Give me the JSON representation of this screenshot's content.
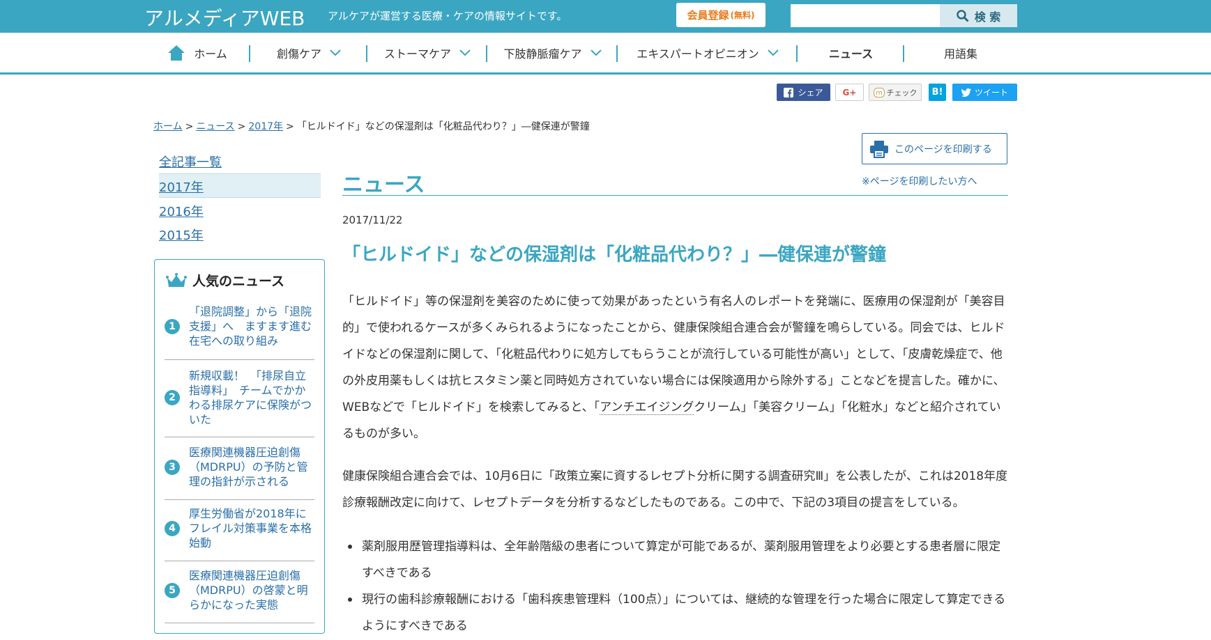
{
  "header": {
    "logo": "アルメディアWEB",
    "tagline": "アルケアが運営する医療・ケアの情報サイトです。",
    "register_label": "会員登録",
    "register_note": "(無料)",
    "search_placeholder": "",
    "search_button": "検 索"
  },
  "nav": [
    {
      "label": "ホーム"
    },
    {
      "label": "創傷ケア"
    },
    {
      "label": "ストーマケア"
    },
    {
      "label": "下肢静脈瘤ケア"
    },
    {
      "label": "エキスパートオピニオン"
    },
    {
      "label": "ニュース"
    },
    {
      "label": "用語集"
    }
  ],
  "social": {
    "facebook": "シェア",
    "google": "G+",
    "mixi": "チェック",
    "hatena": "B!",
    "twitter": "ツイート"
  },
  "breadcrumb": {
    "home": "ホーム",
    "news": "ニュース",
    "year": "2017年",
    "current": "「ヒルドイド」などの保湿剤は「化粧品代わり？」―健保連が警鐘"
  },
  "sidebar": {
    "links": [
      "全記事一覧",
      "2017年",
      "2016年",
      "2015年"
    ],
    "popular_title": "人気のニュース",
    "popular": [
      {
        "num": "1",
        "text": "「退院調整」から「退院支援」へ　ますます進む在宅への取り組み"
      },
      {
        "num": "2",
        "text": "新規収載！　「排尿自立指導料」　チームでかかわる排尿ケアに保険がついた"
      },
      {
        "num": "3",
        "text": "医療関連機器圧迫創傷（MDRPU）の予防と管理の指針が示される"
      },
      {
        "num": "4",
        "text": "厚生労働省が2018年にフレイル対策事業を本格始動"
      },
      {
        "num": "5",
        "text": "医療関連機器圧迫創傷（MDRPU）の啓蒙と明らかになった実態"
      }
    ]
  },
  "print": {
    "button": "このページを印刷する",
    "note": "※ページを印刷したい方へ"
  },
  "main": {
    "section_title": "ニュース",
    "date": "2017/11/22",
    "title": "「ヒルドイド」などの保湿剤は「化粧品代わり？」―健保連が警鐘",
    "para1_a": "「ヒルドイド」等の保湿剤を美容のために使って効果があったという有名人のレポートを発端に、医療用の保湿剤が「美容目的」で使われるケースが多くみられるようになったことから、健康保険組合連合会が警鐘を鳴らしている。同会では、ヒルドイドなどの保湿剤に関して、「化粧品代わりに処方してもらうことが流行している可能性が高い」として、「皮膚乾燥症で、他の外皮用薬もしくは抗ヒスタミン薬と同時処方されていない場合には保険適用から除外する」ことなどを提言した。確かに、WEBなどで「ヒルドイド」を検索してみると、「",
    "para1_link": "アンチエイジング",
    "para1_b": "クリーム」「美容クリーム」「化粧水」などと紹介されているものが多い。",
    "para2": "健康保険組合連合会では、10月6日に「政策立案に資するレセプト分析に関する調査研究Ⅲ」を公表したが、これは2018年度診療報酬改定に向けて、レセプトデータを分析するなどしたものである。この中で、下記の3項目の提言をしている。",
    "bullets": [
      "薬剤服用歴管理指導料は、全年齢階級の患者について算定が可能であるが、薬剤服用管理をより必要とする患者層に限定すべきである",
      "現行の歯科診療報酬における「歯科疾患管理料（100点）」については、継続的な管理を行った場合に限定して算定できるようにすべきである"
    ]
  },
  "colors": {
    "brand": "#3aa6c2",
    "link": "#2a6fa8",
    "register": "#e87b1a"
  }
}
